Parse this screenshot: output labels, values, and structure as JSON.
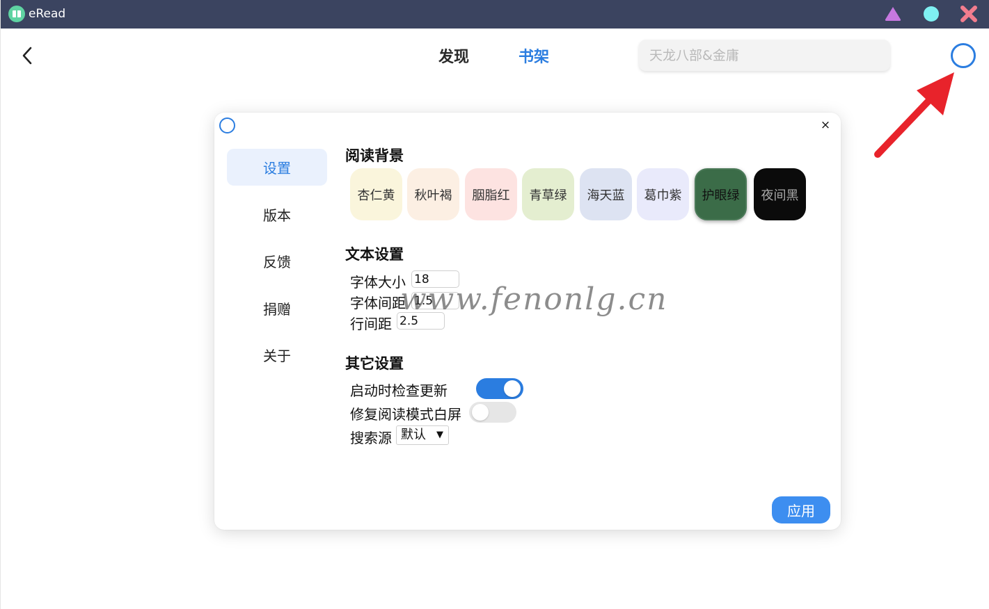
{
  "app": {
    "title": "eRead"
  },
  "header": {
    "tabs": [
      {
        "label": "发现",
        "active": false
      },
      {
        "label": "书架",
        "active": true
      }
    ],
    "search": {
      "placeholder": "天龙八部&金庸",
      "value": ""
    }
  },
  "colors": {
    "accent": "#2b7de0",
    "titlebar": "#3b4460",
    "apply_button": "#3d8ef0",
    "annotation_arrow": "#e8232b"
  },
  "settings_modal": {
    "close_label": "×",
    "sidebar": [
      "设置",
      "版本",
      "反馈",
      "捐赠",
      "关于"
    ],
    "sidebar_active": "设置",
    "reading_background": {
      "title": "阅读背景",
      "options": [
        {
          "label": "杏仁黄",
          "color": "#faf5dc",
          "text_color": "#333333"
        },
        {
          "label": "秋叶褐",
          "color": "#fcefe3",
          "text_color": "#333333"
        },
        {
          "label": "胭脂红",
          "color": "#fde3e1",
          "text_color": "#333333"
        },
        {
          "label": "青草绿",
          "color": "#e4eed0",
          "text_color": "#333333"
        },
        {
          "label": "海天蓝",
          "color": "#dde3f2",
          "text_color": "#333333"
        },
        {
          "label": "葛巾紫",
          "color": "#e9eafb",
          "text_color": "#333333"
        },
        {
          "label": "护眼绿",
          "color": "#3b6c48",
          "text_color": "#111111"
        },
        {
          "label": "夜间黑",
          "color": "#0b0b0b",
          "text_color": "#aaaaaa"
        }
      ],
      "selected": "护眼绿"
    },
    "text_settings": {
      "title": "文本设置",
      "font_size": {
        "label": "字体大小",
        "value": "18"
      },
      "letter_spacing": {
        "label": "字体间距",
        "value": "1.5"
      },
      "line_height": {
        "label": "行间距",
        "value": "2.5"
      }
    },
    "other_settings": {
      "title": "其它设置",
      "check_update": {
        "label": "启动时检查更新",
        "enabled": true
      },
      "fix_white_screen": {
        "label": "修复阅读模式白屏",
        "enabled": false
      },
      "search_source": {
        "label": "搜索源",
        "value": "默认"
      }
    },
    "apply_label": "应用"
  },
  "watermark": "www.fenonlg.cn"
}
